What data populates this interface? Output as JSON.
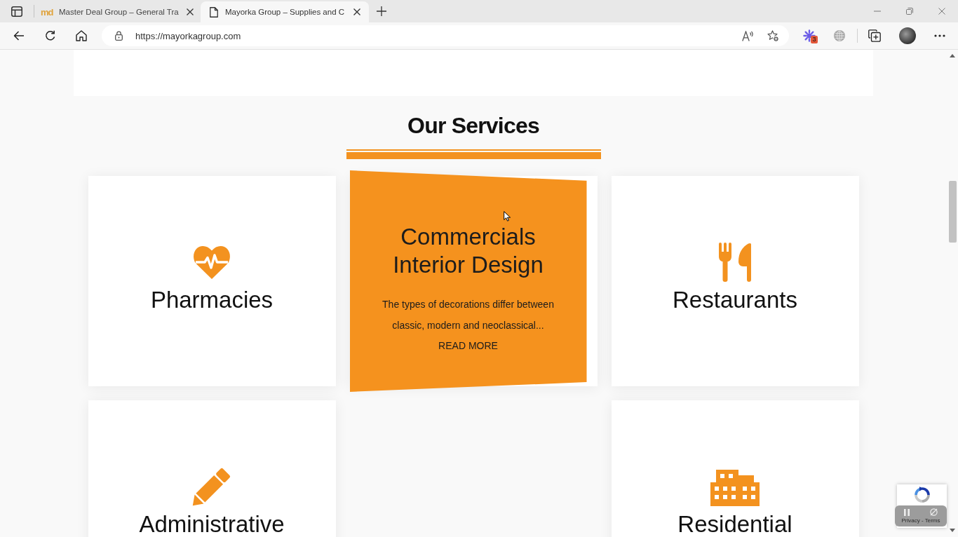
{
  "browser": {
    "tabs": [
      {
        "title": "Master Deal Group – General Tra",
        "logo_text": "md",
        "selected": false
      },
      {
        "title": "Mayorka Group – Supplies and C",
        "selected": true
      }
    ],
    "url": "https://mayorkagroup.com",
    "extension_badge": "3"
  },
  "page": {
    "heading": "Our Services",
    "services": [
      {
        "kind": "heart",
        "title": "Pharmacies",
        "hovered": false
      },
      {
        "title": "Commercials Interior Design",
        "description": "The types of decorations differ between classic, modern and neoclassical...",
        "link": "READ MORE",
        "hovered": true
      },
      {
        "kind": "fork-knife",
        "title": "Restaurants",
        "hovered": false
      },
      {
        "kind": "pencil",
        "title": "Administrative",
        "hovered": false
      },
      {
        "kind": "building",
        "title": "Residential",
        "hovered": false
      }
    ]
  },
  "recaptcha": {
    "links": "Privacy - Terms"
  }
}
